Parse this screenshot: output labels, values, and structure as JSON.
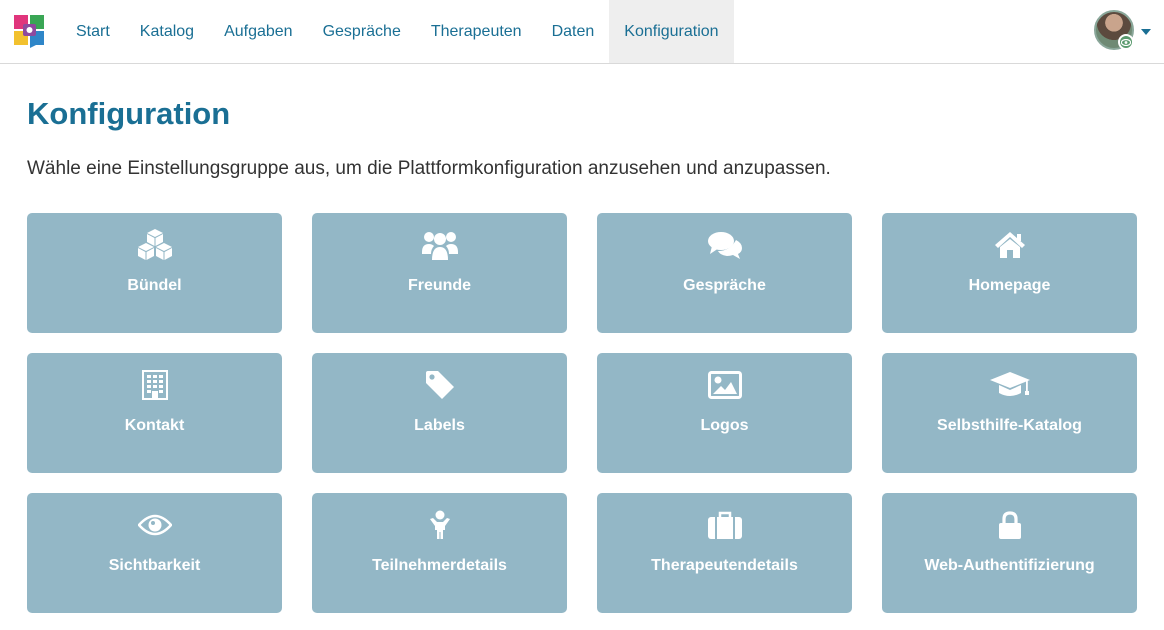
{
  "app": {
    "logo_icon": "app-logo-icon",
    "colors": {
      "brand": "#1a6f94",
      "tile": "#93b7c6",
      "active_nav": "#eeeeee"
    }
  },
  "nav": {
    "items": [
      {
        "label": "Start"
      },
      {
        "label": "Katalog"
      },
      {
        "label": "Aufgaben"
      },
      {
        "label": "Gespräche"
      },
      {
        "label": "Therapeuten"
      },
      {
        "label": "Daten"
      },
      {
        "label": "Konfiguration",
        "active": true
      }
    ]
  },
  "user": {
    "avatar_icon": "user-avatar",
    "badge_icon": "eye-icon"
  },
  "page": {
    "title": "Konfiguration",
    "description": "Wähle eine Einstellungsgruppe aus, um die Plattformkonfiguration anzusehen und anzupassen."
  },
  "tiles": [
    {
      "label": "Bündel",
      "icon": "cubes-icon"
    },
    {
      "label": "Freunde",
      "icon": "users-icon"
    },
    {
      "label": "Gespräche",
      "icon": "comments-icon"
    },
    {
      "label": "Homepage",
      "icon": "home-icon"
    },
    {
      "label": "Kontakt",
      "icon": "building-icon"
    },
    {
      "label": "Labels",
      "icon": "tag-icon"
    },
    {
      "label": "Logos",
      "icon": "image-icon"
    },
    {
      "label": "Selbsthilfe-Katalog",
      "icon": "graduation-cap-icon"
    },
    {
      "label": "Sichtbarkeit",
      "icon": "eye-icon"
    },
    {
      "label": "Teilnehmerdetails",
      "icon": "child-icon"
    },
    {
      "label": "Therapeutendetails",
      "icon": "suitcase-icon"
    },
    {
      "label": "Web-Authentifizierung",
      "icon": "lock-icon"
    }
  ]
}
